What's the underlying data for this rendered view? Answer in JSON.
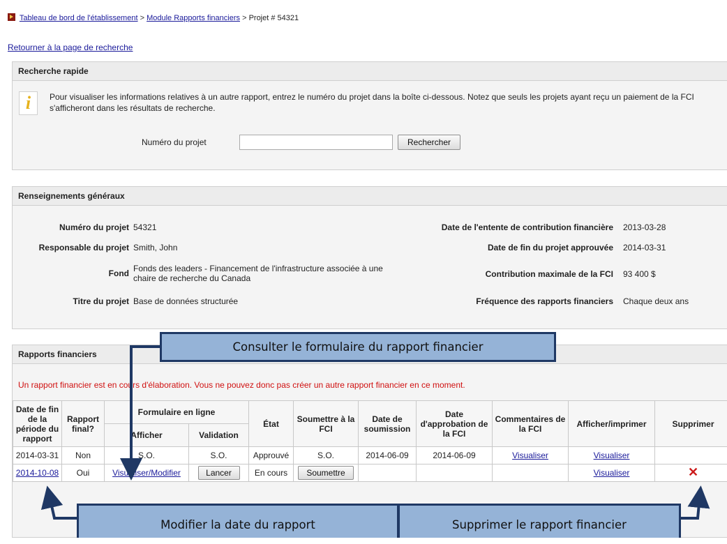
{
  "breadcrumb": {
    "items": [
      "Tableau de bord de l'établissement",
      "Module Rapports financiers"
    ],
    "separator": ">",
    "current": "Projet # 54321"
  },
  "back_link": "Retourner à la page de recherche",
  "quick_search": {
    "title": "Recherche rapide",
    "info_icon": "info-i-icon",
    "message": "Pour visualiser les informations relatives à un autre rapport, entrez le numéro du projet dans la boîte ci-dessous. Notez que seuls les projets ayant reçu un paiement de la FCI s'afficheront dans les résultats de recherche.",
    "field_label": "Numéro du projet",
    "field_value": "",
    "button": "Rechercher"
  },
  "general_info": {
    "title": "Renseignements généraux",
    "left": [
      {
        "label": "Numéro du projet",
        "value": "54321"
      },
      {
        "label": "Responsable du projet",
        "value": "Smith, John"
      },
      {
        "label": "Fond",
        "value": "Fonds des leaders - Financement de l'infrastructure associée à une chaire de recherche du Canada"
      },
      {
        "label": "Titre du projet",
        "value": "Base de données structurée"
      }
    ],
    "right": [
      {
        "label": "Date de l'entente de contribution financière",
        "value": "2013-03-28"
      },
      {
        "label": "Date de fin du projet approuvée",
        "value": "2014-03-31"
      },
      {
        "label": "Contribution maximale de la FCI",
        "value": "93 400 $"
      },
      {
        "label": "Fréquence des rapports financiers",
        "value": "Chaque deux ans"
      }
    ]
  },
  "financial_reports": {
    "title": "Rapports financiers",
    "warning": "Un rapport financier est en cours d'élaboration. Vous ne pouvez donc pas créer un autre rapport financier en ce moment.",
    "headers": {
      "end_date": "Date de fin de la période du rapport",
      "final": "Rapport final?",
      "online_form": "Formulaire en ligne",
      "view": "Afficher",
      "validation": "Validation",
      "status": "État",
      "submit": "Soumettre à la FCI",
      "submission_date": "Date de soumission",
      "approval_date": "Date d'approbation de la FCI",
      "comments": "Commentaires de la FCI",
      "print": "Afficher/imprimer",
      "delete": "Supprimer"
    },
    "rows": [
      {
        "end_date": "2014-03-31",
        "final": "Non",
        "view": "S.O.",
        "validation": "S.O.",
        "status": "Approuvé",
        "submit": "S.O.",
        "submission_date": "2014-06-09",
        "approval_date": "2014-06-09",
        "comments": "Visualiser",
        "print": "Visualiser",
        "delete": ""
      },
      {
        "end_date": "2014-10-08",
        "final": "Oui",
        "view": "Visualiser/Modifier",
        "validation": "Lancer",
        "status": "En cours",
        "submit": "Soumettre",
        "submission_date": "",
        "approval_date": "",
        "comments": "",
        "print": "Visualiser",
        "delete": "✕"
      }
    ]
  },
  "callouts": {
    "view_form": "Consulter le formulaire du rapport financier",
    "edit_date": "Modifier la date du rapport",
    "delete_report": "Supprimer le rapport financier",
    "color": "#95b3d7",
    "border": "#1f3864"
  }
}
